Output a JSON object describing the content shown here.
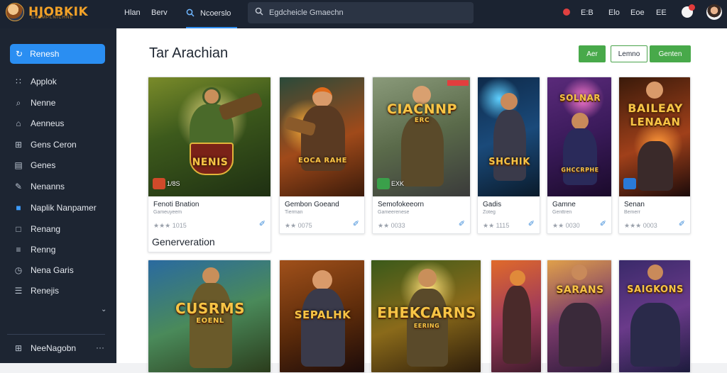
{
  "header": {
    "logo_text": "HJOBKIK",
    "logo_subtitle": "EXEMPLNICHNE",
    "nav": [
      "Hlan",
      "Berv"
    ],
    "active_nav": "Ncoerslo",
    "search_placeholder": "Egdcheicle Gmaechn",
    "right_items": [
      "E:B",
      "Elo",
      "Eoe",
      "EE"
    ]
  },
  "sidebar": {
    "active": "Renesh",
    "items": [
      {
        "icon": "apps-icon",
        "label": "Applok"
      },
      {
        "icon": "search-icon",
        "label": "Nenne"
      },
      {
        "icon": "home-icon",
        "label": "Aenneus"
      },
      {
        "icon": "grid-icon",
        "label": "Gens Ceron"
      },
      {
        "icon": "window-icon",
        "label": "Genes"
      },
      {
        "icon": "pen-icon",
        "label": "Nenanns"
      },
      {
        "icon": "square-icon",
        "label": "Naplik Nanpamer"
      },
      {
        "icon": "box-icon",
        "label": "Renang"
      },
      {
        "icon": "chart-icon",
        "label": "Renng"
      },
      {
        "icon": "clock-icon",
        "label": "Nena Garis"
      },
      {
        "icon": "list-icon",
        "label": "Renejis"
      }
    ],
    "footer_label": "NeeNagobn",
    "footer_more": "···"
  },
  "main": {
    "title": "Tar Arachian",
    "buttons": {
      "green1": "Aer",
      "outline": "Lemno",
      "green2": "Genten"
    },
    "section_label": "Generveration"
  },
  "cards_row1": [
    {
      "title": "NENIS",
      "name": "Fenoti Bnation",
      "genre": "Gameuyeem",
      "rating": "★★★ 1015",
      "badge": "1/8S"
    },
    {
      "title": "EOCA RAHE",
      "name": "Gembon Goeand",
      "genre": "Tierman",
      "rating": "★★ 0075"
    },
    {
      "title": "CIACNNP",
      "title2": "ERC",
      "name": "Semofokeeorn",
      "genre": "Gameerenese",
      "rating": "★★ 0033",
      "badge": "EXK"
    },
    {
      "title": "SHCHIK",
      "name": "Gadis",
      "genre": "Zoteg",
      "rating": "★★ 1115"
    },
    {
      "title": "SOLNAR",
      "title2": "GHCCRPHE",
      "name": "Gamne",
      "genre": "Genttren",
      "rating": "★★ 0030"
    },
    {
      "title": "BAILEAY",
      "title2": "LENAAN",
      "name": "Senan",
      "genre": "Bemerr",
      "rating": "★★★ 0003"
    }
  ],
  "cards_row2": [
    {
      "title": "CUSRMS",
      "title2": "EOENL"
    },
    {
      "title": "SEPALHK"
    },
    {
      "title": "EHEKCARNS",
      "title2": "EERING"
    },
    {
      "title": ""
    },
    {
      "title": "SARANS"
    },
    {
      "title": "SAIGKONS"
    }
  ],
  "colors": {
    "accent": "#2a8ef2",
    "green": "#48a94a",
    "topbar": "#1b2331",
    "sidebar": "#1d2532"
  }
}
